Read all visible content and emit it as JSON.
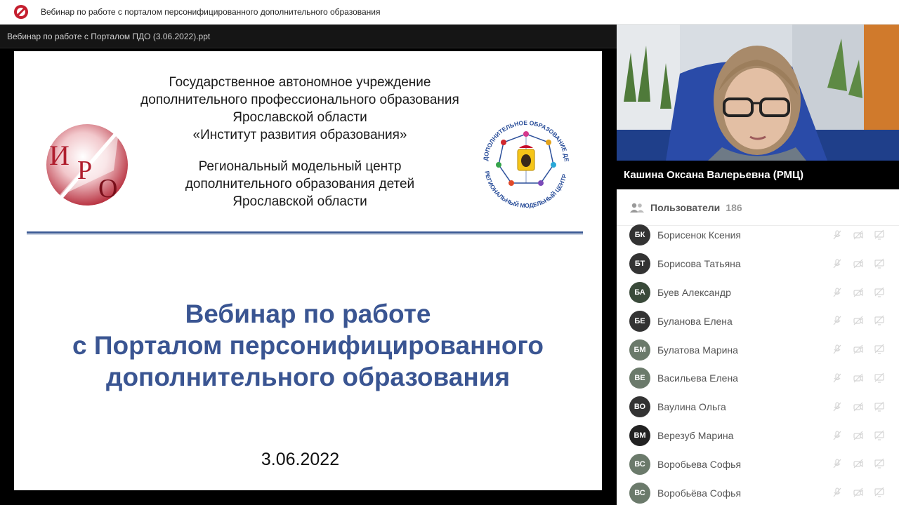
{
  "header": {
    "title": "Вебинар по работе с порталом персонифицированного дополнительного образования"
  },
  "presentation": {
    "filename": "Вебинар по работе с Порталом ПДО (3.06.2022).ppt",
    "slide": {
      "org_lines": [
        "Государственное автономное учреждение",
        "дополнительного профессионального образования",
        "Ярославской области",
        "«Институт развития образования»"
      ],
      "center_lines": [
        "Региональный модельный центр",
        "дополнительного образования детей",
        "Ярославской области"
      ],
      "iro_logo_letters": [
        "И",
        "Р",
        "О"
      ],
      "rmc_logo_top_text": "ДОПОЛНИТЕЛЬНОЕ ОБРАЗОВАНИЕ ДЕТЕЙ",
      "rmc_logo_bottom_text": "РЕГИОНАЛЬНЫЙ МОДЕЛЬНЫЙ ЦЕНТР",
      "title_lines": [
        "Вебинар по работе",
        "с Порталом персонифицированного",
        "дополнительного образования"
      ],
      "date": "3.06.2022"
    }
  },
  "speaker": {
    "name": "Кашина Оксана Валерьевна (РМЦ)"
  },
  "participants": {
    "label": "Пользователи",
    "count": "186",
    "items": [
      {
        "initials": "БК",
        "name": "Борисенок Ксения",
        "color": "#333333"
      },
      {
        "initials": "БТ",
        "name": "Борисова Татьяна",
        "color": "#333333"
      },
      {
        "initials": "БА",
        "name": "Буев Александр",
        "color": "#3a4a3a"
      },
      {
        "initials": "БЕ",
        "name": "Буланова Елена",
        "color": "#333333"
      },
      {
        "initials": "БМ",
        "name": "Булатова Марина",
        "color": "#6b7a6b"
      },
      {
        "initials": "ВЕ",
        "name": "Васильева Елена",
        "color": "#6b7a6b"
      },
      {
        "initials": "ВО",
        "name": "Ваулина Ольга",
        "color": "#333333"
      },
      {
        "initials": "ВМ",
        "name": "Верезуб Марина",
        "color": "#222222"
      },
      {
        "initials": "ВС",
        "name": "Воробьева Софья",
        "color": "#6b7a6b"
      },
      {
        "initials": "ВС",
        "name": "Воробьёва Софья",
        "color": "#6b7a6b"
      }
    ]
  },
  "colors": {
    "title_blue": "#3a5592",
    "rule_blue": "#3c5a94",
    "iro_red": "#b01e2e"
  }
}
